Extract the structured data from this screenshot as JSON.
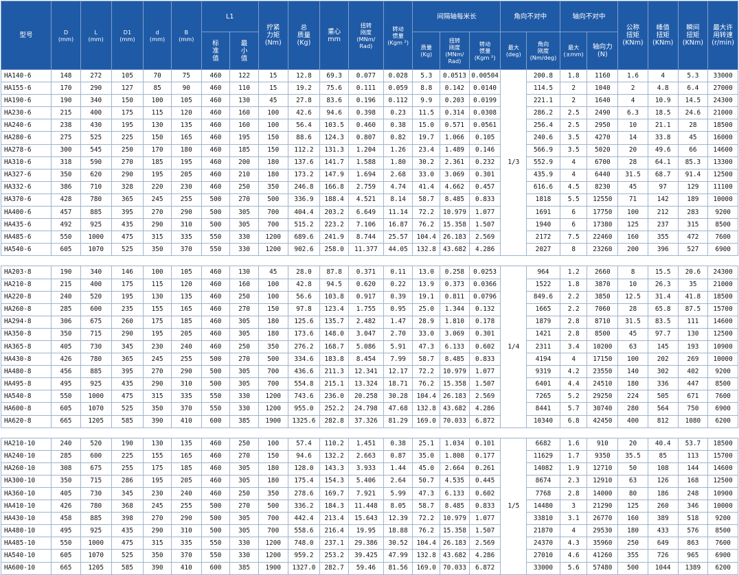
{
  "headers": {
    "model": [
      "型号"
    ],
    "D": [
      "D",
      "(mm)"
    ],
    "L": [
      "L",
      "(mm)"
    ],
    "D1": [
      "D1",
      "(mm)"
    ],
    "d": [
      "d",
      "(mm)"
    ],
    "B": [
      "B",
      "(mm)"
    ],
    "L1": [
      "L1"
    ],
    "L1_std": [
      "标",
      "准",
      "值"
    ],
    "L1_min": [
      "最",
      "小",
      "值"
    ],
    "tighten": [
      "拧紧",
      "力矩",
      "(Nm)"
    ],
    "mass": [
      "总",
      "质量",
      "(Kg)"
    ],
    "cog": [
      "重心",
      "mm"
    ],
    "tstiff": [
      "扭转",
      "刚度",
      "(MNm/",
      "Rad)"
    ],
    "inertia": [
      "转动",
      "惯量",
      "(Kgm ²)"
    ],
    "per_meter": [
      "间隔轴每米长"
    ],
    "pm_mass": [
      "质量",
      "(Kg)"
    ],
    "pm_tstiff": [
      "扭转",
      "刚度",
      "(MNm/",
      "Rad)"
    ],
    "pm_inertia": [
      "转动",
      "惯量",
      "(Kgm ²)"
    ],
    "angular": [
      "角向不对中"
    ],
    "ang_max": [
      "最大",
      "(deg)"
    ],
    "ang_stiff": [
      "角向",
      "刚度",
      "(Nm/deg)"
    ],
    "axial": [
      "轴向不对中"
    ],
    "ax_max": [
      "最大",
      "(±mm)"
    ],
    "ax_force": [
      "轴向力",
      "(N)"
    ],
    "nom_torque": [
      "公称",
      "扭矩",
      "(KNm)"
    ],
    "peak_torque": [
      "峰值",
      "扭矩",
      "(KNm)"
    ],
    "inst_torque": [
      "瞬间",
      "扭矩",
      "(KNm)"
    ],
    "max_speed": [
      "最大许",
      "用转速",
      "(r/min)"
    ]
  },
  "groups": [
    {
      "misalign": "1/3",
      "rows": [
        [
          "HA140-6",
          "148",
          "272",
          "105",
          "70",
          "75",
          "460",
          "122",
          "15",
          "12.8",
          "69.3",
          "0.077",
          "0.028",
          "5.3",
          "0.0513",
          "0.00504",
          "200.8",
          "1.8",
          "1160",
          "1.6",
          "4",
          "5.3",
          "33000"
        ],
        [
          "HA155-6",
          "170",
          "290",
          "127",
          "85",
          "90",
          "460",
          "110",
          "15",
          "19.2",
          "75.6",
          "0.111",
          "0.059",
          "8.8",
          "0.142",
          "0.0140",
          "114.5",
          "2",
          "1040",
          "2",
          "4.8",
          "6.4",
          "27000"
        ],
        [
          "HA190-6",
          "190",
          "340",
          "150",
          "100",
          "105",
          "460",
          "130",
          "45",
          "27.8",
          "83.6",
          "0.196",
          "0.112",
          "9.9",
          "0.203",
          "0.0199",
          "221.1",
          "2",
          "1640",
          "4",
          "10.9",
          "14.5",
          "24300"
        ],
        [
          "HA230-6",
          "215",
          "400",
          "175",
          "115",
          "120",
          "460",
          "160",
          "100",
          "42.6",
          "94.6",
          "0.398",
          "0.23",
          "11.5",
          "0.314",
          "0.0308",
          "286.2",
          "2.5",
          "2490",
          "6.3",
          "18.5",
          "24.6",
          "21000"
        ],
        [
          "HA240-6",
          "238",
          "430",
          "195",
          "130",
          "135",
          "460",
          "160",
          "100",
          "56.4",
          "103.5",
          "0.460",
          "0.38",
          "15.0",
          "0.571",
          "0.0561",
          "256.4",
          "2.5",
          "2950",
          "10",
          "21.1",
          "28",
          "18500"
        ],
        [
          "HA280-6",
          "275",
          "525",
          "225",
          "150",
          "165",
          "460",
          "195",
          "150",
          "88.6",
          "124.3",
          "0.807",
          "0.82",
          "19.7",
          "1.066",
          "0.105",
          "240.6",
          "3.5",
          "4270",
          "14",
          "33.8",
          "45",
          "16000"
        ],
        [
          "HA278-6",
          "300",
          "545",
          "250",
          "170",
          "180",
          "460",
          "185",
          "150",
          "112.2",
          "131.3",
          "1.204",
          "1.26",
          "23.4",
          "1.489",
          "0.146",
          "566.9",
          "3.5",
          "5020",
          "20",
          "49.6",
          "66",
          "14600"
        ],
        [
          "HA310-6",
          "318",
          "590",
          "270",
          "185",
          "195",
          "460",
          "200",
          "180",
          "137.6",
          "141.7",
          "1.588",
          "1.80",
          "30.2",
          "2.361",
          "0.232",
          "552.9",
          "4",
          "6700",
          "28",
          "64.1",
          "85.3",
          "13300"
        ],
        [
          "HA327-6",
          "350",
          "620",
          "290",
          "195",
          "205",
          "460",
          "210",
          "180",
          "173.2",
          "147.9",
          "1.694",
          "2.68",
          "33.0",
          "3.069",
          "0.301",
          "435.9",
          "4",
          "6440",
          "31.5",
          "68.7",
          "91.4",
          "12500"
        ],
        [
          "HA332-6",
          "386",
          "710",
          "328",
          "220",
          "230",
          "460",
          "250",
          "350",
          "246.8",
          "166.8",
          "2.759",
          "4.74",
          "41.4",
          "4.662",
          "0.457",
          "616.6",
          "4.5",
          "8230",
          "45",
          "97",
          "129",
          "11100"
        ],
        [
          "HA370-6",
          "428",
          "780",
          "365",
          "245",
          "255",
          "500",
          "270",
          "500",
          "336.9",
          "188.4",
          "4.521",
          "8.14",
          "58.7",
          "8.485",
          "0.833",
          "1818",
          "5.5",
          "12550",
          "71",
          "142",
          "189",
          "10000"
        ],
        [
          "HA400-6",
          "457",
          "885",
          "395",
          "270",
          "290",
          "500",
          "305",
          "700",
          "404.4",
          "203.2",
          "6.649",
          "11.14",
          "72.2",
          "10.979",
          "1.077",
          "1691",
          "6",
          "17750",
          "100",
          "212",
          "283",
          "9200"
        ],
        [
          "HA435-6",
          "492",
          "925",
          "435",
          "290",
          "310",
          "500",
          "305",
          "700",
          "515.2",
          "223.2",
          "7.106",
          "16.87",
          "76.2",
          "15.358",
          "1.507",
          "1940",
          "6",
          "17380",
          "125",
          "237",
          "315",
          "8500"
        ],
        [
          "HA485-6",
          "550",
          "1000",
          "475",
          "315",
          "335",
          "550",
          "330",
          "1200",
          "689.6",
          "241.9",
          "8.744",
          "25.57",
          "104.4",
          "26.183",
          "2.569",
          "2172",
          "7.5",
          "22460",
          "160",
          "355",
          "472",
          "7600"
        ],
        [
          "HA540-6",
          "605",
          "1070",
          "525",
          "350",
          "370",
          "550",
          "330",
          "1200",
          "902.6",
          "258.0",
          "11.377",
          "44.05",
          "132.8",
          "43.682",
          "4.286",
          "2027",
          "8",
          "23260",
          "200",
          "396",
          "527",
          "6900"
        ]
      ]
    },
    {
      "misalign": "1/4",
      "rows": [
        [
          "HA203-8",
          "190",
          "340",
          "146",
          "100",
          "105",
          "460",
          "130",
          "45",
          "28.0",
          "87.8",
          "0.371",
          "0.11",
          "13.0",
          "0.258",
          "0.0253",
          "964",
          "1.2",
          "2660",
          "8",
          "15.5",
          "20.6",
          "24300"
        ],
        [
          "HA210-8",
          "215",
          "400",
          "175",
          "115",
          "120",
          "460",
          "160",
          "100",
          "42.8",
          "94.5",
          "0.620",
          "0.22",
          "13.9",
          "0.373",
          "0.0366",
          "1522",
          "1.8",
          "3870",
          "10",
          "26.3",
          "35",
          "21000"
        ],
        [
          "HA220-8",
          "240",
          "520",
          "195",
          "130",
          "135",
          "460",
          "250",
          "100",
          "56.6",
          "103.8",
          "0.917",
          "0.39",
          "19.1",
          "0.811",
          "0.0796",
          "849.6",
          "2.2",
          "3850",
          "12.5",
          "31.4",
          "41.8",
          "18500"
        ],
        [
          "HA260-8",
          "285",
          "600",
          "235",
          "155",
          "165",
          "460",
          "270",
          "150",
          "97.8",
          "123.4",
          "1.755",
          "0.95",
          "25.0",
          "1.344",
          "0.132",
          "1665",
          "2.2",
          "7060",
          "28",
          "65.8",
          "87.5",
          "15700"
        ],
        [
          "HA294-8",
          "306",
          "675",
          "260",
          "175",
          "185",
          "460",
          "305",
          "180",
          "125.6",
          "135.7",
          "2.482",
          "1.47",
          "28.9",
          "1.810",
          "0.178",
          "1879",
          "2.8",
          "8710",
          "31.5",
          "83.5",
          "111",
          "14600"
        ],
        [
          "HA350-8",
          "350",
          "715",
          "290",
          "195",
          "205",
          "460",
          "305",
          "180",
          "173.6",
          "148.0",
          "3.047",
          "2.70",
          "33.0",
          "3.069",
          "0.301",
          "1421",
          "2.8",
          "8500",
          "45",
          "97.7",
          "130",
          "12500"
        ],
        [
          "HA365-8",
          "405",
          "730",
          "345",
          "230",
          "240",
          "460",
          "250",
          "350",
          "276.2",
          "168.7",
          "5.086",
          "5.91",
          "47.3",
          "6.133",
          "0.602",
          "2311",
          "3.4",
          "10200",
          "63",
          "145",
          "193",
          "10900"
        ],
        [
          "HA430-8",
          "426",
          "780",
          "365",
          "245",
          "255",
          "500",
          "270",
          "500",
          "334.6",
          "183.8",
          "8.454",
          "7.99",
          "58.7",
          "8.485",
          "0.833",
          "4194",
          "4",
          "17150",
          "100",
          "202",
          "269",
          "10000"
        ],
        [
          "HA480-8",
          "456",
          "885",
          "395",
          "270",
          "290",
          "500",
          "305",
          "700",
          "436.6",
          "211.3",
          "12.341",
          "12.17",
          "72.2",
          "10.979",
          "1.077",
          "9319",
          "4.2",
          "23550",
          "140",
          "302",
          "402",
          "9200"
        ],
        [
          "HA495-8",
          "495",
          "925",
          "435",
          "290",
          "310",
          "500",
          "305",
          "700",
          "554.8",
          "215.1",
          "13.324",
          "18.71",
          "76.2",
          "15.358",
          "1.507",
          "6401",
          "4.4",
          "24510",
          "180",
          "336",
          "447",
          "8500"
        ],
        [
          "HA540-8",
          "550",
          "1000",
          "475",
          "315",
          "335",
          "550",
          "330",
          "1200",
          "743.6",
          "236.0",
          "20.258",
          "30.28",
          "104.4",
          "26.183",
          "2.569",
          "7265",
          "5.2",
          "29250",
          "224",
          "505",
          "671",
          "7600"
        ],
        [
          "HA600-8",
          "605",
          "1070",
          "525",
          "350",
          "370",
          "550",
          "330",
          "1200",
          "955.0",
          "252.2",
          "24.798",
          "47.68",
          "132.8",
          "43.682",
          "4.286",
          "8441",
          "5.7",
          "30740",
          "280",
          "564",
          "750",
          "6900"
        ],
        [
          "HA620-8",
          "665",
          "1205",
          "585",
          "390",
          "410",
          "600",
          "385",
          "1900",
          "1325.6",
          "282.8",
          "37.326",
          "81.29",
          "169.0",
          "70.033",
          "6.872",
          "10340",
          "6.8",
          "42450",
          "400",
          "812",
          "1080",
          "6200"
        ]
      ]
    },
    {
      "misalign": "1/5",
      "rows": [
        [
          "HA210-10",
          "240",
          "520",
          "190",
          "130",
          "135",
          "460",
          "250",
          "100",
          "57.4",
          "110.2",
          "1.451",
          "0.38",
          "25.1",
          "1.034",
          "0.101",
          "6682",
          "1.6",
          "910",
          "20",
          "40.4",
          "53.7",
          "18500"
        ],
        [
          "HA240-10",
          "285",
          "600",
          "225",
          "155",
          "165",
          "460",
          "270",
          "150",
          "94.6",
          "132.2",
          "2.663",
          "0.87",
          "35.0",
          "1.808",
          "0.177",
          "11629",
          "1.7",
          "9350",
          "35.5",
          "85",
          "113",
          "15700"
        ],
        [
          "HA260-10",
          "308",
          "675",
          "255",
          "175",
          "185",
          "460",
          "305",
          "180",
          "128.0",
          "143.3",
          "3.933",
          "1.44",
          "45.0",
          "2.664",
          "0.261",
          "14082",
          "1.9",
          "12710",
          "50",
          "108",
          "144",
          "14600"
        ],
        [
          "HA300-10",
          "350",
          "715",
          "286",
          "195",
          "205",
          "460",
          "305",
          "180",
          "175.4",
          "154.3",
          "5.406",
          "2.64",
          "50.7",
          "4.535",
          "0.445",
          "8674",
          "2.3",
          "12910",
          "63",
          "126",
          "168",
          "12500"
        ],
        [
          "HA360-10",
          "405",
          "730",
          "345",
          "230",
          "240",
          "460",
          "250",
          "350",
          "278.6",
          "169.7",
          "7.921",
          "5.99",
          "47.3",
          "6.133",
          "0.602",
          "7768",
          "2.8",
          "14000",
          "80",
          "186",
          "248",
          "10900"
        ],
        [
          "HA410-10",
          "426",
          "780",
          "368",
          "245",
          "255",
          "500",
          "270",
          "500",
          "336.2",
          "184.3",
          "11.448",
          "8.05",
          "58.7",
          "8.485",
          "0.833",
          "14480",
          "3",
          "21290",
          "125",
          "260",
          "346",
          "10000"
        ],
        [
          "HA430-10",
          "458",
          "885",
          "398",
          "270",
          "290",
          "500",
          "305",
          "700",
          "442.4",
          "213.4",
          "15.643",
          "12.39",
          "72.2",
          "10.979",
          "1.077",
          "33810",
          "3.1",
          "26770",
          "160",
          "389",
          "518",
          "9200"
        ],
        [
          "HA480-10",
          "495",
          "925",
          "435",
          "290",
          "310",
          "500",
          "305",
          "700",
          "558.6",
          "216.4",
          "19.95",
          "18.88",
          "76.2",
          "15.358",
          "1.507",
          "21870",
          "4",
          "29530",
          "180",
          "433",
          "576",
          "8500"
        ],
        [
          "HA485-10",
          "550",
          "1000",
          "475",
          "315",
          "335",
          "550",
          "330",
          "1200",
          "748.0",
          "237.1",
          "29.386",
          "30.52",
          "104.4",
          "26.183",
          "2.569",
          "24370",
          "4.3",
          "35960",
          "250",
          "649",
          "863",
          "7600"
        ],
        [
          "HA540-10",
          "605",
          "1070",
          "525",
          "350",
          "370",
          "550",
          "330",
          "1200",
          "959.2",
          "253.2",
          "39.425",
          "47.99",
          "132.8",
          "43.682",
          "4.286",
          "27010",
          "4.6",
          "41260",
          "355",
          "726",
          "965",
          "6900"
        ],
        [
          "HA600-10",
          "665",
          "1205",
          "585",
          "390",
          "410",
          "600",
          "385",
          "1900",
          "1327.0",
          "282.7",
          "59.46",
          "81.56",
          "169.0",
          "70.033",
          "6.872",
          "33000",
          "5.6",
          "57480",
          "500",
          "1044",
          "1389",
          "6200"
        ]
      ]
    }
  ]
}
